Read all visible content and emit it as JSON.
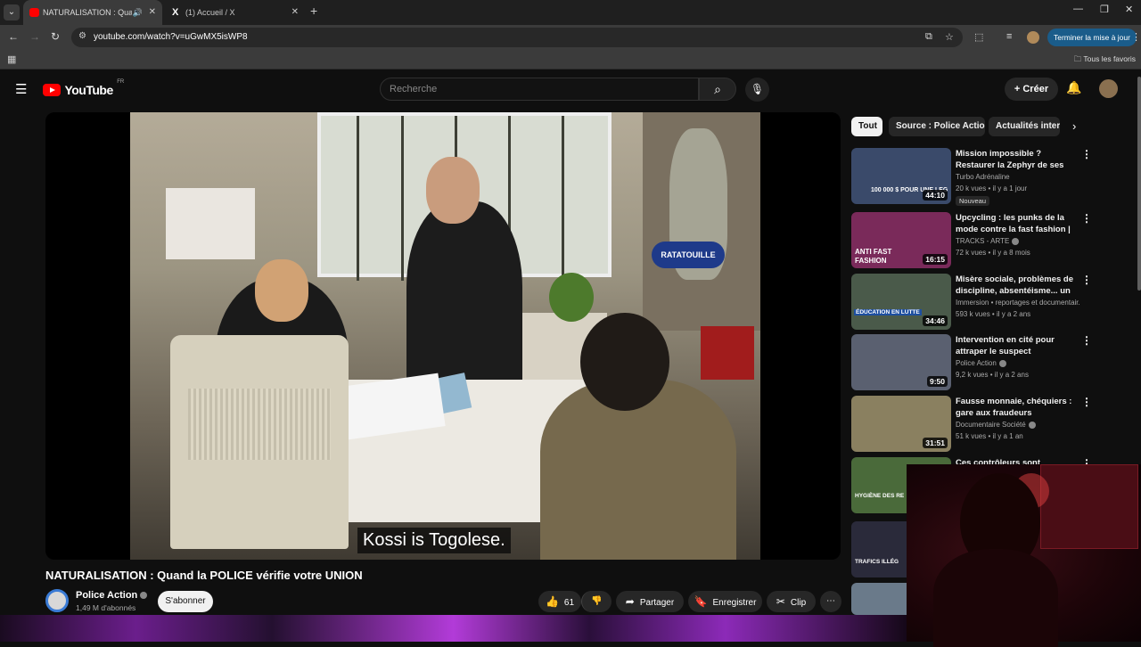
{
  "browser": {
    "tabs": [
      {
        "title": "NATURALISATION : Quand la POLICE vérifie votre UNION"
      },
      {
        "title": "(1) Accueil / X"
      }
    ],
    "url": "youtube.com/watch?v=uGwMX5isWP8",
    "update_label": "Terminer la mise à jour",
    "bookmarks_label": "Tous les favoris"
  },
  "youtube": {
    "logo_text": "YouTube",
    "country": "FR",
    "search_placeholder": "Recherche",
    "create_label": "Créer"
  },
  "video": {
    "subtitle": "Kossi is Togolese.",
    "poster_sign": "RATATOUILLE",
    "title": "NATURALISATION : Quand la POLICE vérifie votre UNION",
    "channel": "Police Action",
    "subscribers": "1,49 M d'abonnés",
    "subscribe_label": "S'abonner",
    "likes": "61",
    "share_label": "Partager",
    "save_label": "Enregistrer",
    "clip_label": "Clip"
  },
  "chips": [
    "Tout",
    "Source : Police Action",
    "Actualités internationales"
  ],
  "related": [
    {
      "title": "Mission impossible ? Restaurer la Zephyr de ses rêves | Car ...",
      "channel": "Turbo Adrénaline",
      "meta": "20 k vues • il y a 1 jour",
      "duration": "44:10",
      "badge": "Nouveau",
      "color": "#3a4a6a"
    },
    {
      "title": "Upcycling : les punks de la mode contre la fast fashion | ...",
      "channel": "TRACKS - ARTE",
      "meta": "72 k vues • il y a 8 mois",
      "duration": "16:15",
      "color": "#7a2a5a"
    },
    {
      "title": "Misère sociale, problèmes de discipline, absentéisme... un ...",
      "channel": "Immersion • reportages et documentair...",
      "meta": "593 k vues • il y a 2 ans",
      "duration": "34:46",
      "color": "#4a5a4a"
    },
    {
      "title": "Intervention en cité pour attraper le suspect",
      "channel": "Police Action",
      "meta": "9,2 k vues • il y a 2 ans",
      "duration": "9:50",
      "color": "#5a6070"
    },
    {
      "title": "Fausse monnaie, chéquiers : gare aux fraudeurs",
      "channel": "Documentaire Société",
      "meta": "51 k vues • il y a 1 an",
      "duration": "31:51",
      "color": "#8a8060"
    },
    {
      "title": "Ces contrôleurs sont choqués",
      "color": "#4a6a3a"
    },
    {
      "color": "#2a2a3a"
    },
    {
      "color": "#6a7a8a"
    }
  ],
  "thumb_texts": [
    "100 000 $ POUR UNE LEG",
    "ANTI FAST FASHION",
    "ÉDUCATION EN LUTTE",
    "HYGIÈNE DES RE",
    "TRAFICS ILLÉG"
  ]
}
